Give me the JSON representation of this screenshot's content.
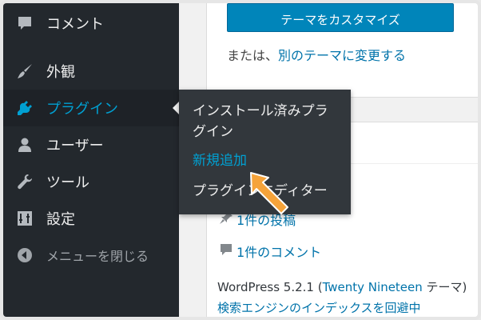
{
  "sidebar": {
    "items": [
      {
        "label": "コメント",
        "icon": "comment-icon"
      },
      {
        "label": "外観",
        "icon": "paintbrush-icon"
      },
      {
        "label": "プラグイン",
        "icon": "plugin-icon"
      },
      {
        "label": "ユーザー",
        "icon": "user-icon"
      },
      {
        "label": "ツール",
        "icon": "wrench-icon"
      },
      {
        "label": "設定",
        "icon": "settings-icon"
      },
      {
        "label": "メニューを閉じる",
        "icon": "collapse-icon"
      }
    ]
  },
  "flyout": {
    "installed_line1": "インストール済みプラ",
    "installed_line2": "グイン",
    "add_new": "新規追加",
    "editor": "プラグインエディター"
  },
  "content": {
    "theme_button": "テーマをカスタマイズ",
    "or_text": "または、",
    "change_theme": "別のテーマに変更する",
    "posts_count": "1件の投稿",
    "comments_count": "1件のコメント",
    "wp_version": "WordPress 5.2.1 (",
    "theme_name": "Twenty Nineteen",
    "theme_suffix": " テーマ)",
    "search_engine": "検索エンジンのインデックスを回避中"
  },
  "colors": {
    "sidebar_bg": "#23282d",
    "flyout_bg": "#32373c",
    "accent": "#00a0d2",
    "link": "#0073aa",
    "arrow": "#f5a33a"
  }
}
